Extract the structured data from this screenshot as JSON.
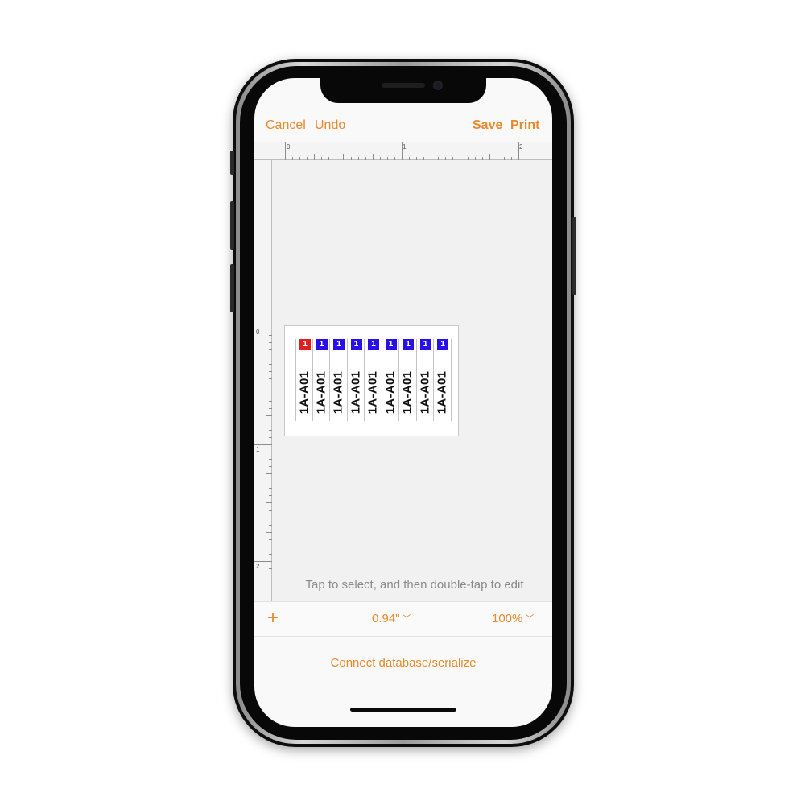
{
  "nav": {
    "cancel": "Cancel",
    "undo": "Undo",
    "save": "Save",
    "print": "Print"
  },
  "ruler": {
    "h_labels": [
      "0",
      "1",
      "2"
    ],
    "v_labels": [
      "0",
      "1",
      "2"
    ]
  },
  "labels": [
    {
      "number": "1",
      "text": "1A-A01",
      "color": "#e02020"
    },
    {
      "number": "1",
      "text": "1A-A01",
      "color": "#2a10e8"
    },
    {
      "number": "1",
      "text": "1A-A01",
      "color": "#2a10e8"
    },
    {
      "number": "1",
      "text": "1A-A01",
      "color": "#2a10e8"
    },
    {
      "number": "1",
      "text": "1A-A01",
      "color": "#2a10e8"
    },
    {
      "number": "1",
      "text": "1A-A01",
      "color": "#2a10e8"
    },
    {
      "number": "1",
      "text": "1A-A01",
      "color": "#2a10e8"
    },
    {
      "number": "1",
      "text": "1A-A01",
      "color": "#2a10e8"
    },
    {
      "number": "1",
      "text": "1A-A01",
      "color": "#2a10e8"
    }
  ],
  "hint": "Tap to select, and then double-tap to edit",
  "toolbar": {
    "add_icon": "plus-icon",
    "length_value": "0.94\"",
    "zoom_value": "100%"
  },
  "connect": "Connect database/serialize",
  "accent_color": "#e8892b"
}
